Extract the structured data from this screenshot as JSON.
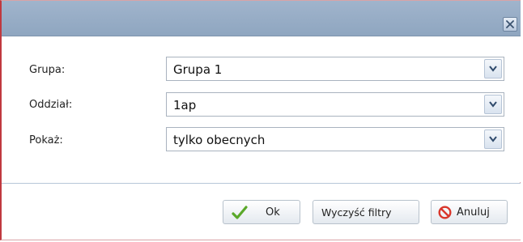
{
  "dialog": {
    "close_icon": "close-icon",
    "fields": [
      {
        "label": "Grupa:",
        "value": "Grupa 1"
      },
      {
        "label": "Oddział:",
        "value": "1ap"
      },
      {
        "label": "Pokaż:",
        "value": "tylko obecnych"
      }
    ],
    "buttons": {
      "ok": {
        "label": "Ok",
        "icon": "checkmark-icon",
        "icon_color": "#5aa82a"
      },
      "clear": {
        "label": "Wyczyść filtry"
      },
      "cancel": {
        "label": "Anuluj",
        "icon": "cancel-icon",
        "icon_color": "#d9362b"
      }
    }
  },
  "colors": {
    "titlebar": "#97adc6",
    "border_accent": "#c0393f"
  }
}
